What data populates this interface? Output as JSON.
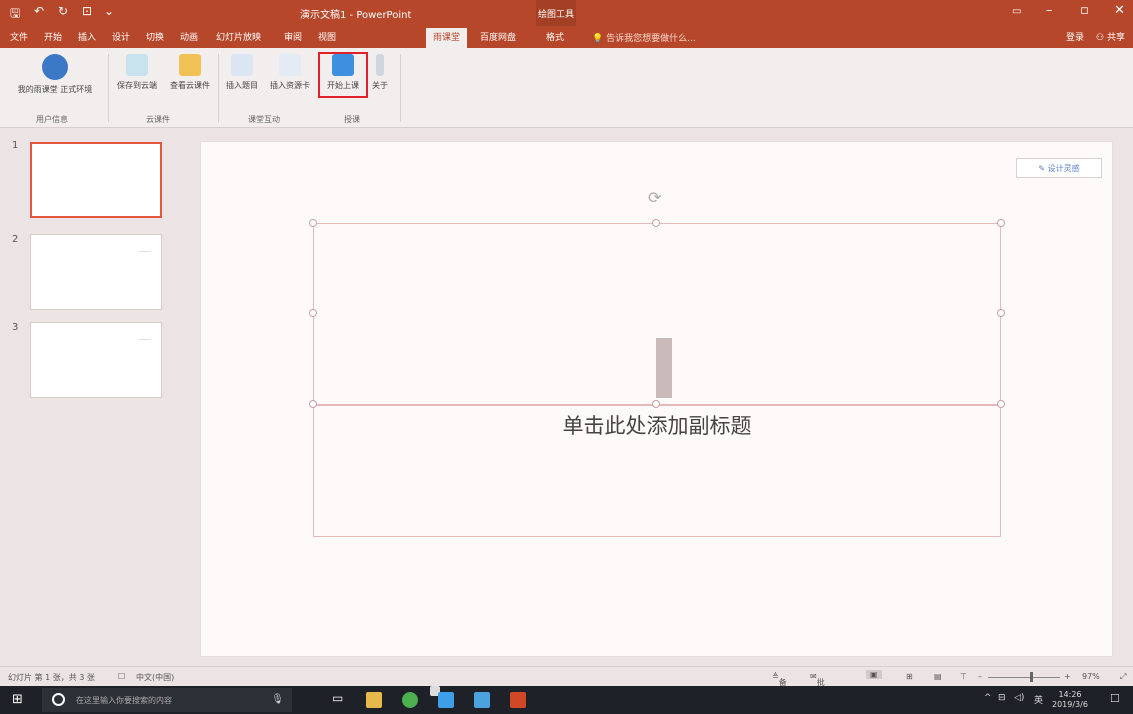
{
  "titlebar": {
    "title": "演示文稿1 - PowerPoint",
    "contextual_tab": "绘图工具",
    "save_icon": "save-icon",
    "undo_icon": "undo-icon",
    "redo_icon": "redo-icon"
  },
  "tabs": [
    {
      "label": "文件"
    },
    {
      "label": "开始"
    },
    {
      "label": "插入"
    },
    {
      "label": "设计"
    },
    {
      "label": "切换"
    },
    {
      "label": "动画"
    },
    {
      "label": "幻灯片放映"
    },
    {
      "label": "审阅"
    },
    {
      "label": "视图"
    },
    {
      "label": "雨课堂"
    },
    {
      "label": "百度网盘"
    },
    {
      "label": "格式"
    }
  ],
  "tell_me": "告诉我您想要做什么...",
  "account": {
    "login": "登录",
    "share": "共享"
  },
  "ribbon": {
    "buttons": [
      {
        "label": "我的雨课堂 正式环境"
      },
      {
        "label": "保存到云端"
      },
      {
        "label": "查看云课件"
      },
      {
        "label": "插入题目"
      },
      {
        "label": "插入资源卡"
      },
      {
        "label": "开始上课"
      },
      {
        "label": "关于"
      }
    ],
    "groups": [
      {
        "label": "用户信息"
      },
      {
        "label": "云课件"
      },
      {
        "label": "课堂互动"
      },
      {
        "label": "授课"
      }
    ]
  },
  "thumbnails": [
    {
      "number": "1",
      "mini_text": ""
    },
    {
      "number": "2",
      "mini_text": "———"
    },
    {
      "number": "3",
      "mini_text": "———"
    }
  ],
  "slide": {
    "subtitle_placeholder": "单击此处添加副标题",
    "design_ideas": "设计灵感"
  },
  "statusbar": {
    "slide_info": "幻灯片 第 1 张，共 3 张",
    "language": "中文(中国)",
    "notes": "备注",
    "comments": "批注",
    "zoom": "97%"
  },
  "taskbar": {
    "search_placeholder": "在这里输入你要搜索的内容",
    "time": "14:26",
    "date": "2019/3/6",
    "ime": "英"
  }
}
